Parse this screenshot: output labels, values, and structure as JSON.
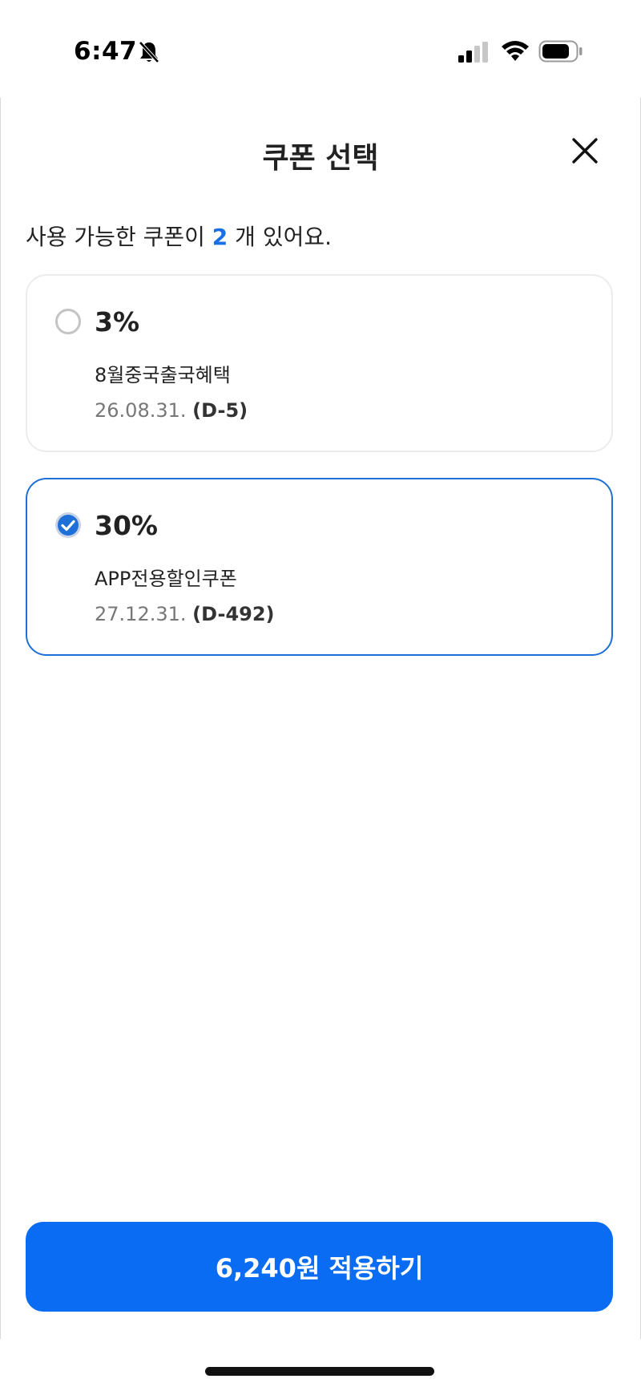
{
  "status_bar": {
    "time": "6:47",
    "icons": [
      "bell-slash-icon",
      "cellular-signal-icon",
      "wifi-icon",
      "battery-icon"
    ]
  },
  "header": {
    "title": "쿠폰 선택",
    "close_icon": "close-icon"
  },
  "available": {
    "prefix": "사용 가능한 쿠폰이 ",
    "count": "2",
    "suffix": " 개 있어요."
  },
  "coupons": [
    {
      "discount": "3%",
      "name": "8월중국출국혜택",
      "expiry": "26.08.31. ",
      "dday": "(D-5)",
      "selected": false
    },
    {
      "discount": "30%",
      "name": "APP전용할인쿠폰",
      "expiry": "27.12.31. ",
      "dday": "(D-492)",
      "selected": true
    }
  ],
  "apply_button": {
    "label": "6,240원 적용하기"
  },
  "colors": {
    "accent": "#0a6cf3",
    "selected_border": "#1f6fd8",
    "count_text": "#1a6fe6"
  }
}
